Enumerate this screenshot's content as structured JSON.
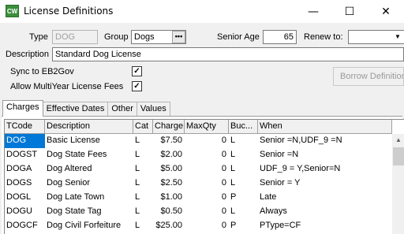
{
  "window": {
    "app_icon_text": "CW",
    "title": "License Definitions",
    "minimize_glyph": "—",
    "maximize_glyph": "☐",
    "close_glyph": "✕"
  },
  "form": {
    "type_label": "Type",
    "type_value": "DOG",
    "group_label": "Group",
    "group_value": "Dogs",
    "group_lookup_glyph": "•••",
    "senior_age_label": "Senior Age",
    "senior_age_value": "65",
    "renew_to_label": "Renew to:",
    "renew_to_value": "",
    "renew_arrow_glyph": "▼",
    "description_label": "Description",
    "description_value": "Standard Dog License",
    "sync_label": "Sync to EB2Gov",
    "sync_checked": true,
    "multiyear_label": "Allow MultiYear License Fees",
    "multiyear_checked": true,
    "check_glyph": "✓",
    "borrow_button_label": "Borrow Definitions"
  },
  "tabs": [
    "Charges",
    "Effective Dates",
    "Other",
    "Values"
  ],
  "grid": {
    "columns": [
      "TCode",
      "Description",
      "Cat",
      "Charge",
      "MaxQty",
      "Buc...",
      "When"
    ],
    "rows": [
      [
        "DOG",
        "Basic License",
        "L",
        "$7.50",
        "0",
        "L",
        "Senior =N,UDF_9 =N"
      ],
      [
        "DOGST",
        "Dog State Fees",
        "L",
        "$2.00",
        "0",
        "L",
        "Senior =N"
      ],
      [
        "DOGA",
        "Dog Altered",
        "L",
        "$5.00",
        "0",
        "L",
        "UDF_9 = Y,Senior=N"
      ],
      [
        "DOGS",
        "Dog Senior",
        "L",
        "$2.50",
        "0",
        "L",
        "Senior = Y"
      ],
      [
        "DOGL",
        "Dog Late Town",
        "L",
        "$1.00",
        "0",
        "P",
        "Late"
      ],
      [
        "DOGU",
        "Dog State Tag",
        "L",
        "$0.50",
        "0",
        "L",
        "Always"
      ],
      [
        "DOGCF",
        "Dog Civil Forfeiture",
        "L",
        "$25.00",
        "0",
        "P",
        "PType=CF"
      ]
    ],
    "selected_row": 0,
    "scroll_up_glyph": "▲"
  },
  "colors": {
    "selection": "#0078d7",
    "app_icon": "#3a8f3a"
  }
}
